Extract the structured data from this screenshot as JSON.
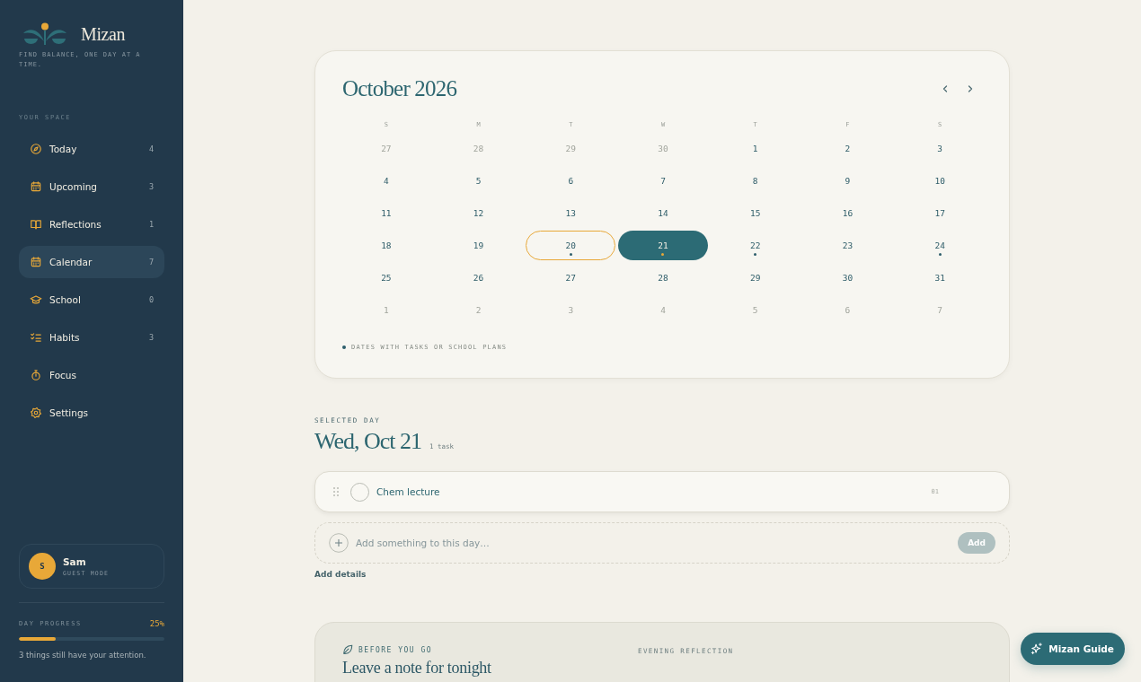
{
  "sidebar": {
    "brand": {
      "name": "Mizan",
      "tagline": "FIND BALANCE, ONE DAY AT A TIME."
    },
    "section_label": "YOUR SPACE",
    "nav_items": [
      {
        "label": "Today",
        "count": "4",
        "selected": false
      },
      {
        "label": "Upcoming",
        "count": "3",
        "selected": false
      },
      {
        "label": "Reflections",
        "count": "1",
        "selected": false
      },
      {
        "label": "Calendar",
        "count": "7",
        "selected": true
      },
      {
        "label": "School",
        "count": "0",
        "selected": false
      },
      {
        "label": "Habits",
        "count": "3",
        "selected": false
      },
      {
        "label": "Focus",
        "selected": false
      },
      {
        "label": "Settings",
        "selected": false
      }
    ],
    "user": {
      "initial": "S",
      "name": "Sam",
      "mode": "GUEST MODE"
    },
    "day_progress": {
      "label": "DAY PROGRESS",
      "reading": "25%",
      "level": 0.25,
      "note": "3 things still have your attention."
    }
  },
  "calendar": {
    "title": "October 2026",
    "weekdays": [
      "S",
      "M",
      "T",
      "W",
      "T",
      "F",
      "S"
    ],
    "weeks": [
      [
        {
          "day": "27",
          "outside": true,
          "today": false,
          "selected": false,
          "has_plans": false
        },
        {
          "day": "28",
          "outside": true,
          "today": false,
          "selected": false,
          "has_plans": false
        },
        {
          "day": "29",
          "outside": true,
          "today": false,
          "selected": false,
          "has_plans": false
        },
        {
          "day": "30",
          "outside": true,
          "today": false,
          "selected": false,
          "has_plans": false
        },
        {
          "day": "1",
          "outside": false,
          "today": false,
          "selected": false,
          "has_plans": false
        },
        {
          "day": "2",
          "outside": false,
          "today": false,
          "selected": false,
          "has_plans": false
        },
        {
          "day": "3",
          "outside": false,
          "today": false,
          "selected": false,
          "has_plans": false
        }
      ],
      [
        {
          "day": "4",
          "outside": false,
          "today": false,
          "selected": false,
          "has_plans": false
        },
        {
          "day": "5",
          "outside": false,
          "today": false,
          "selected": false,
          "has_plans": false
        },
        {
          "day": "6",
          "outside": false,
          "today": false,
          "selected": false,
          "has_plans": false
        },
        {
          "day": "7",
          "outside": false,
          "today": false,
          "selected": false,
          "has_plans": false
        },
        {
          "day": "8",
          "outside": false,
          "today": false,
          "selected": false,
          "has_plans": false
        },
        {
          "day": "9",
          "outside": false,
          "today": false,
          "selected": false,
          "has_plans": false
        },
        {
          "day": "10",
          "outside": false,
          "today": false,
          "selected": false,
          "has_plans": false
        }
      ],
      [
        {
          "day": "11",
          "outside": false,
          "today": false,
          "selected": false,
          "has_plans": false
        },
        {
          "day": "12",
          "outside": false,
          "today": false,
          "selected": false,
          "has_plans": false
        },
        {
          "day": "13",
          "outside": false,
          "today": false,
          "selected": false,
          "has_plans": false
        },
        {
          "day": "14",
          "outside": false,
          "today": false,
          "selected": false,
          "has_plans": false
        },
        {
          "day": "15",
          "outside": false,
          "today": false,
          "selected": false,
          "has_plans": false
        },
        {
          "day": "16",
          "outside": false,
          "today": false,
          "selected": false,
          "has_plans": false
        },
        {
          "day": "17",
          "outside": false,
          "today": false,
          "selected": false,
          "has_plans": false
        }
      ],
      [
        {
          "day": "18",
          "outside": false,
          "today": false,
          "selected": false,
          "has_plans": false
        },
        {
          "day": "19",
          "outside": false,
          "today": false,
          "selected": false,
          "has_plans": false
        },
        {
          "day": "20",
          "outside": false,
          "today": true,
          "selected": false,
          "has_plans": true
        },
        {
          "day": "21",
          "outside": false,
          "today": false,
          "selected": true,
          "has_plans": true
        },
        {
          "day": "22",
          "outside": false,
          "today": false,
          "selected": false,
          "has_plans": true
        },
        {
          "day": "23",
          "outside": false,
          "today": false,
          "selected": false,
          "has_plans": false
        },
        {
          "day": "24",
          "outside": false,
          "today": false,
          "selected": false,
          "has_plans": true
        }
      ],
      [
        {
          "day": "25",
          "outside": false,
          "today": false,
          "selected": false,
          "has_plans": false
        },
        {
          "day": "26",
          "outside": false,
          "today": false,
          "selected": false,
          "has_plans": false
        },
        {
          "day": "27",
          "outside": false,
          "today": false,
          "selected": false,
          "has_plans": false
        },
        {
          "day": "28",
          "outside": false,
          "today": false,
          "selected": false,
          "has_plans": false
        },
        {
          "day": "29",
          "outside": false,
          "today": false,
          "selected": false,
          "has_plans": false
        },
        {
          "day": "30",
          "outside": false,
          "today": false,
          "selected": false,
          "has_plans": false
        },
        {
          "day": "31",
          "outside": false,
          "today": false,
          "selected": false,
          "has_plans": false
        }
      ],
      [
        {
          "day": "1",
          "outside": true,
          "today": false,
          "selected": false,
          "has_plans": false
        },
        {
          "day": "2",
          "outside": true,
          "today": false,
          "selected": false,
          "has_plans": false
        },
        {
          "day": "3",
          "outside": true,
          "today": false,
          "selected": false,
          "has_plans": false
        },
        {
          "day": "4",
          "outside": true,
          "today": false,
          "selected": false,
          "has_plans": false
        },
        {
          "day": "5",
          "outside": true,
          "today": false,
          "selected": false,
          "has_plans": false
        },
        {
          "day": "6",
          "outside": true,
          "today": false,
          "selected": false,
          "has_plans": false
        },
        {
          "day": "7",
          "outside": true,
          "today": false,
          "selected": false,
          "has_plans": false
        }
      ]
    ],
    "legend": "DATES WITH TASKS OR SCHOOL PLANS"
  },
  "selected_day": {
    "label": "SELECTED DAY",
    "title": "Wed, Oct 21",
    "count": "1 task",
    "tasks": [
      {
        "title": "Chem lecture",
        "done": false,
        "number": "01"
      }
    ],
    "add_field": {
      "placeholder": "Add something to this day…"
    },
    "add_button": {
      "label": "Add",
      "disabled": true
    },
    "details_link": "Add details"
  },
  "reflection": {
    "eyebrow": "BEFORE YOU GO",
    "title": "Leave a note for tonight",
    "side_label": "EVENING REFLECTION"
  },
  "guide_button": {
    "label": "Mizan Guide"
  }
}
